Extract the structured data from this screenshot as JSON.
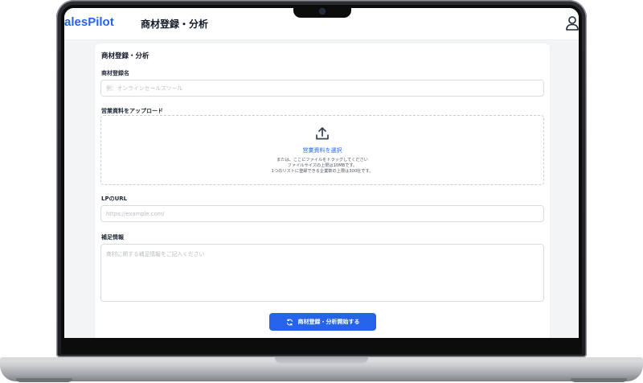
{
  "header": {
    "brand": "alesPilot",
    "title": "商材登録・分析",
    "user_icon": "user-icon"
  },
  "form": {
    "card_title": "商材登録・分析",
    "product_name": {
      "label": "商材登録名",
      "placeholder": "例：オンラインセールスツール",
      "value": ""
    },
    "upload": {
      "label": "営業資料をアップロード",
      "icon": "upload-icon",
      "select_label": "営業資料を選択",
      "notes": [
        "または、ここにファイルをドラッグしてください",
        "ファイルサイズの上限は10MBです。",
        "1つのリストに登録できる企業数の上限は300社です。"
      ]
    },
    "lp_url": {
      "label": "LPのURL",
      "placeholder": "https://example.com/",
      "value": ""
    },
    "supplement": {
      "label": "補足情報",
      "placeholder": "商材に関する補足情報をご記入ください",
      "value": ""
    },
    "submit": {
      "label": "商材登録・分析開始する",
      "icon": "refresh-icon"
    }
  },
  "colors": {
    "accent": "#2563eb",
    "screen_bg": "#f3f4f6",
    "card_bg": "#ffffff"
  }
}
